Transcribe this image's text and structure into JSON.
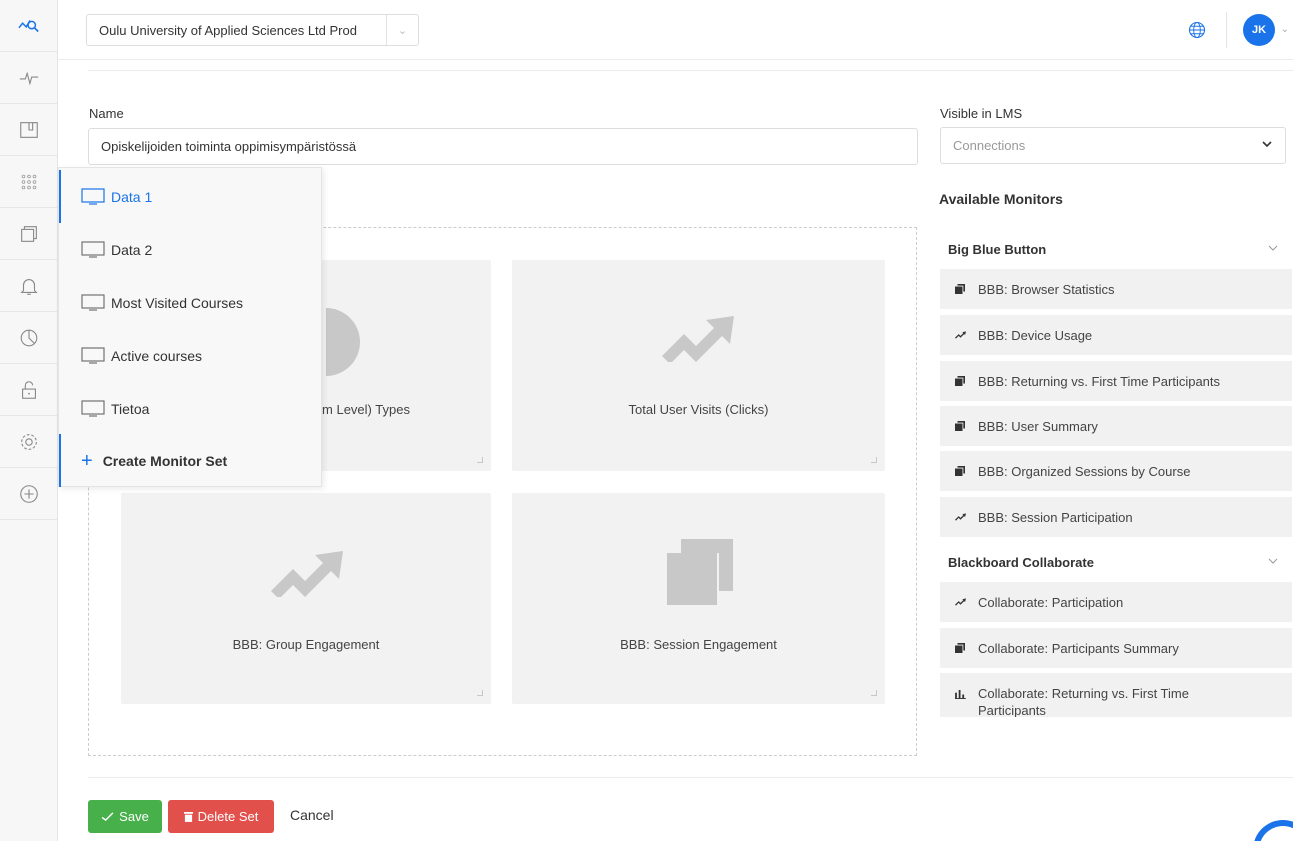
{
  "topbar": {
    "org_name": "Oulu University of Applied Sciences Ltd Prod",
    "avatar_initials": "JK"
  },
  "form": {
    "name_label": "Name",
    "name_value": "Opiskelijoiden toiminta oppimisympäristössä",
    "lms_label": "Visible in LMS",
    "lms_placeholder": "Connections"
  },
  "menu": {
    "items": [
      {
        "label": "Data 1",
        "active": true
      },
      {
        "label": "Data 2"
      },
      {
        "label": "Most Visited Courses"
      },
      {
        "label": "Active courses"
      },
      {
        "label": "Tietoa"
      }
    ],
    "create_label": "Create Monitor Set"
  },
  "tiles": [
    {
      "caption": "m Level) Types",
      "icon": "pie-icon"
    },
    {
      "caption": "Total User Visits (Clicks)",
      "icon": "trend-icon"
    },
    {
      "caption": "BBB: Group Engagement",
      "icon": "trend-icon"
    },
    {
      "caption": "BBB: Session Engagement",
      "icon": "stack-icon"
    }
  ],
  "available": {
    "title": "Available Monitors",
    "groups": [
      {
        "name": "Big Blue Button",
        "items": [
          {
            "label": "BBB: Browser Statistics",
            "icon": "stack-icon"
          },
          {
            "label": "BBB: Device Usage",
            "icon": "trend-icon"
          },
          {
            "label": "BBB: Returning vs. First Time Participants",
            "icon": "stack-icon"
          },
          {
            "label": "BBB: User Summary",
            "icon": "stack-icon"
          },
          {
            "label": "BBB: Organized Sessions by Course",
            "icon": "stack-icon"
          },
          {
            "label": "BBB: Session Participation",
            "icon": "trend-icon"
          }
        ]
      },
      {
        "name": "Blackboard Collaborate",
        "items": [
          {
            "label": "Collaborate: Participation",
            "icon": "trend-icon"
          },
          {
            "label": "Collaborate: Participants Summary",
            "icon": "stack-icon"
          },
          {
            "label": "Collaborate: Returning vs. First Time Participants",
            "icon": "bar-icon"
          }
        ]
      }
    ]
  },
  "actions": {
    "save_label": "Save",
    "delete_label": "Delete Set",
    "cancel_label": "Cancel"
  },
  "colors": {
    "accent": "#1a73e8",
    "save": "#47b04b",
    "delete": "#e2504c"
  }
}
